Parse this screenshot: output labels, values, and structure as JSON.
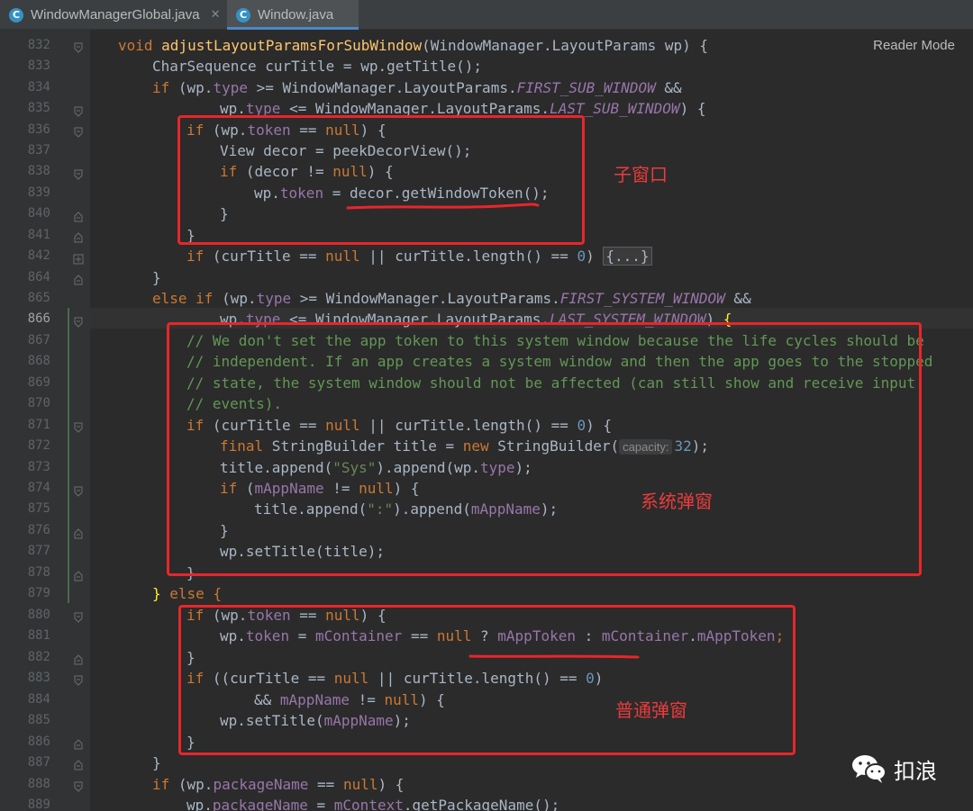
{
  "tabs": [
    {
      "label": "WindowManagerGlobal.java",
      "icon": "java-class-icon",
      "active": false
    },
    {
      "label": "Window.java",
      "icon": "java-class-icon",
      "active": true
    }
  ],
  "reader_mode": "Reader Mode",
  "line_numbers": [
    "832",
    "833",
    "834",
    "835",
    "836",
    "837",
    "838",
    "839",
    "840",
    "841",
    "842",
    "864",
    "865",
    "866",
    "867",
    "868",
    "869",
    "870",
    "871",
    "872",
    "873",
    "874",
    "875",
    "876",
    "877",
    "878",
    "879",
    "880",
    "881",
    "882",
    "883",
    "884",
    "885",
    "886",
    "887",
    "888",
    "889"
  ],
  "current_line": "866",
  "code": {
    "l832": {
      "a": "void",
      "b": " ",
      "c": "adjustLayoutParamsForSubWindow",
      "d": "(WindowManager.LayoutParams wp) {"
    },
    "l833": {
      "a": "CharSequence curTitle = wp.getTitle();"
    },
    "l834": {
      "a": "if",
      "b": " (wp.",
      "c": "type",
      "d": " >= WindowManager.LayoutParams.",
      "e": "FIRST_SUB_WINDOW",
      "f": " &&"
    },
    "l835": {
      "a": "wp.",
      "b": "type",
      "c": " <= WindowManager.LayoutParams.",
      "d": "LAST_SUB_WINDOW",
      "e": ") {"
    },
    "l836": {
      "a": "if",
      "b": " (wp.",
      "c": "token",
      "d": " == ",
      "e": "null",
      "f": ") {"
    },
    "l837": {
      "a": "View decor = peekDecorView();"
    },
    "l838": {
      "a": "if",
      "b": " (decor != ",
      "c": "null",
      "d": ") {"
    },
    "l839": {
      "a": "wp.",
      "b": "token",
      "c": " = decor.getWindowToken();"
    },
    "l840": {
      "a": "}"
    },
    "l841": {
      "a": "}"
    },
    "l842": {
      "a": "if",
      "b": " (curTitle == ",
      "c": "null",
      "d": " || curTitle.length() == ",
      "e": "0",
      "f": ") ",
      "g": "{...}"
    },
    "l864": {
      "a": "}"
    },
    "l865": {
      "a": "else if",
      "b": " (wp.",
      "c": "type",
      "d": " >= WindowManager.LayoutParams.",
      "e": "FIRST_SYSTEM_WINDOW",
      "f": " &&"
    },
    "l866": {
      "a": "wp.",
      "b": "type",
      "c": " <= WindowManager.LayoutParams.",
      "d": "LAST_SYSTEM_WINDOW",
      "e": ") ",
      "f": "{"
    },
    "l867": {
      "a": "// We don't set the app token to this system window because the life cycles should be"
    },
    "l868": {
      "a": "// independent. If an app creates a system window and then the app goes to the stopped"
    },
    "l869": {
      "a": "// state, the system window should not be affected (can still show and receive input"
    },
    "l870": {
      "a": "// events)."
    },
    "l871": {
      "a": "if",
      "b": " (curTitle == ",
      "c": "null",
      "d": " || curTitle.length() == ",
      "e": "0",
      "f": ") {"
    },
    "l872": {
      "a": "final",
      "b": " StringBuilder title = ",
      "c": "new",
      "d": " StringBuilder(",
      "e": "capacity:",
      "f": "32",
      "g": ");"
    },
    "l873": {
      "a": "title.append(",
      "b": "\"Sys\"",
      "c": ").append(wp.",
      "d": "type",
      "e": ");"
    },
    "l874": {
      "a": "if",
      "b": " (",
      "c": "mAppName",
      "d": " != ",
      "e": "null",
      "f": ") {"
    },
    "l875": {
      "a": "title.append(",
      "b": "\":\"",
      "c": ").append(",
      "d": "mAppName",
      "e": ");"
    },
    "l876": {
      "a": "}"
    },
    "l877": {
      "a": "wp.setTitle(title);"
    },
    "l878": {
      "a": "}"
    },
    "l879": {
      "a": "}",
      "b": " else {"
    },
    "l880": {
      "a": "if",
      "b": " (wp.",
      "c": "token",
      "d": " == ",
      "e": "null",
      "f": ") {"
    },
    "l881": {
      "a": "wp.",
      "b": "token",
      "c": " = ",
      "d": "mContainer",
      "e": " == ",
      "f": "null",
      "g": " ? ",
      "h": "mAppToken",
      "i": " : ",
      "j": "mContainer",
      "k": ".",
      "l": "mAppToken",
      "m": ";"
    },
    "l882": {
      "a": "}"
    },
    "l883": {
      "a": "if",
      "b": " ((curTitle == ",
      "c": "null",
      "d": " || curTitle.length() == ",
      "e": "0",
      "f": ")"
    },
    "l884": {
      "a": "&& ",
      "b": "mAppName",
      "c": " != ",
      "d": "null",
      "e": ") {"
    },
    "l885": {
      "a": "wp.setTitle(",
      "b": "mAppName",
      "c": ");"
    },
    "l886": {
      "a": "}"
    },
    "l887": {
      "a": "}"
    },
    "l888": {
      "a": "if",
      "b": " (wp.",
      "c": "packageName",
      "d": " == ",
      "e": "null",
      "f": ") {"
    },
    "l889": {
      "a": "wp.",
      "b": "packageName",
      "c": " = ",
      "d": "mContext",
      "e": ".getPackageName();"
    }
  },
  "annotations": {
    "sub_window": "子窗口",
    "system_window": "系统弹窗",
    "normal_window": "普通弹窗"
  },
  "watermark": {
    "icon": "wechat-icon",
    "text": "扣浪"
  },
  "colors": {
    "annotation_red": "#e8262a",
    "background": "#2b2b2b",
    "gutter": "#313335",
    "keyword": "#cc7832",
    "field": "#9876aa",
    "comment": "#629755",
    "string": "#6a8759",
    "number": "#6897bb",
    "method": "#ffc66d"
  }
}
